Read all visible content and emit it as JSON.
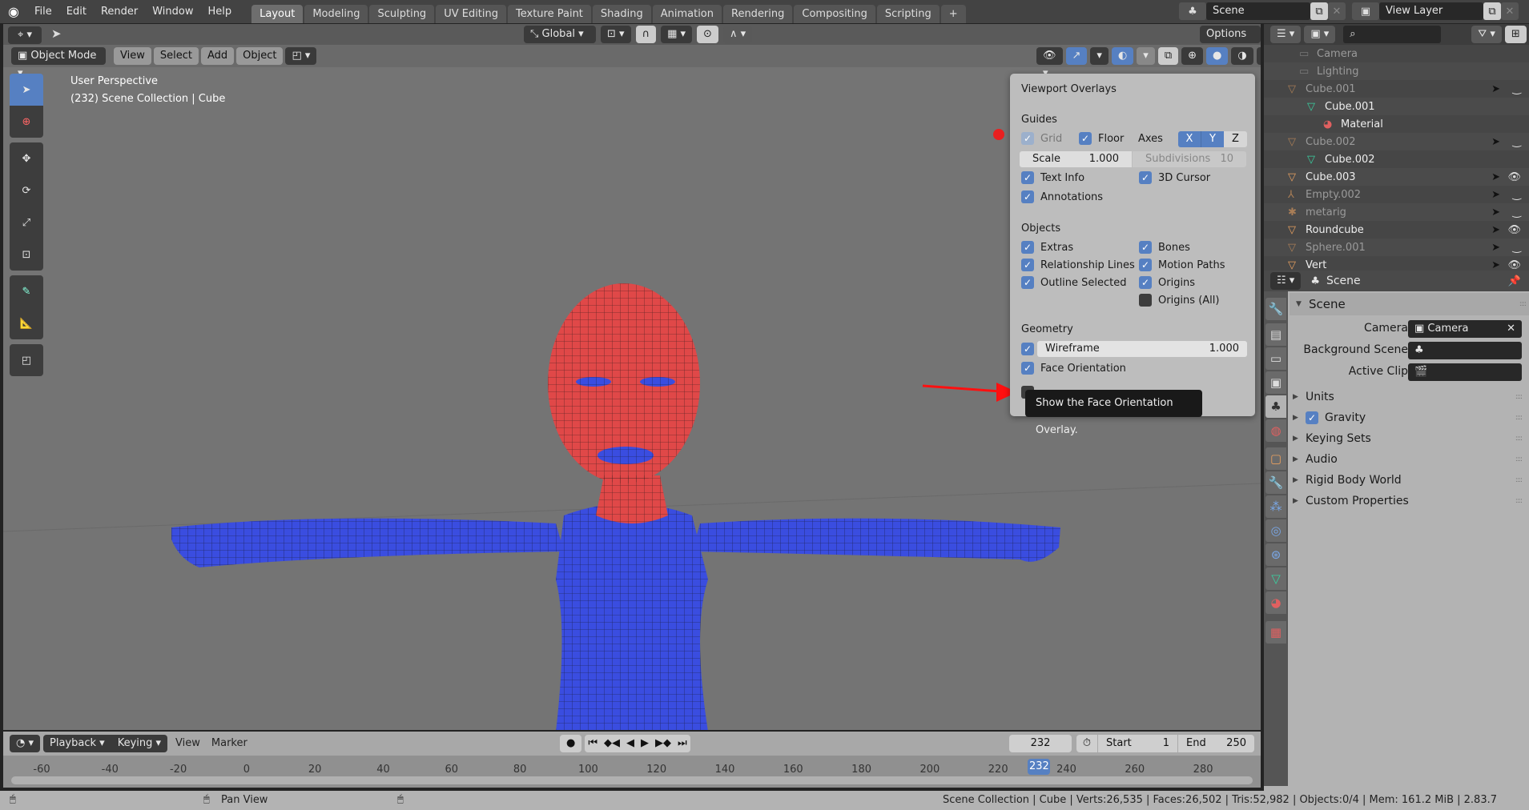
{
  "topbar": {
    "menus": [
      "File",
      "Edit",
      "Render",
      "Window",
      "Help"
    ],
    "workspaces": [
      "Layout",
      "Modeling",
      "Sculpting",
      "UV Editing",
      "Texture Paint",
      "Shading",
      "Animation",
      "Rendering",
      "Compositing",
      "Scripting"
    ],
    "active_workspace": "Layout",
    "add_tab": "+",
    "scene": "Scene",
    "view_layer": "View Layer"
  },
  "viewport": {
    "mode": "Object Mode",
    "menus": [
      "View",
      "Select",
      "Add",
      "Object"
    ],
    "transform_orientation": "Global",
    "options_label": "Options",
    "info_line1": "User Perspective",
    "info_line2": "(232) Scene Collection | Cube",
    "tools": [
      "select-box",
      "cursor",
      "move",
      "rotate",
      "scale",
      "transform",
      "annotate",
      "measure",
      "add-cube"
    ]
  },
  "overlays": {
    "title": "Viewport Overlays",
    "guides_heading": "Guides",
    "grid": "Grid",
    "floor": "Floor",
    "axes": "Axes",
    "axis_x": "X",
    "axis_y": "Y",
    "axis_z": "Z",
    "scale_label": "Scale",
    "scale_value": "1.000",
    "subdivisions_label": "Subdivisions",
    "subdivisions_value": "10",
    "text_info": "Text Info",
    "cursor_3d": "3D Cursor",
    "annotations": "Annotations",
    "objects_heading": "Objects",
    "extras": "Extras",
    "bones": "Bones",
    "relationship_lines": "Relationship Lines",
    "motion_paths": "Motion Paths",
    "outline_selected": "Outline Selected",
    "origins": "Origins",
    "origins_all": "Origins (All)",
    "geometry_heading": "Geometry",
    "wireframe": "Wireframe",
    "wireframe_value": "1.000",
    "face_orientation": "Face Orientation",
    "tooltip": "Show the Face Orientation Overlay."
  },
  "outliner": {
    "search_placeholder": "",
    "rows": [
      {
        "name": "Camera",
        "type": "collection",
        "dim": true
      },
      {
        "name": "Lighting",
        "type": "collection",
        "dim": true
      },
      {
        "name": "Cube.001",
        "type": "object",
        "dim": true,
        "visible": false
      },
      {
        "name": "Cube.001",
        "type": "mesh",
        "dim": false
      },
      {
        "name": "Material",
        "type": "material",
        "dim": false
      },
      {
        "name": "Cube.002",
        "type": "object",
        "dim": true,
        "visible": false
      },
      {
        "name": "Cube.002",
        "type": "mesh",
        "dim": false
      },
      {
        "name": "Cube.003",
        "type": "object",
        "dim": false,
        "visible": true
      },
      {
        "name": "Empty.002",
        "type": "empty",
        "dim": true,
        "visible": false
      },
      {
        "name": "metarig",
        "type": "armature",
        "dim": true,
        "visible": false
      },
      {
        "name": "Roundcube",
        "type": "object",
        "dim": false,
        "visible": true
      },
      {
        "name": "Sphere.001",
        "type": "object",
        "dim": true,
        "visible": false
      },
      {
        "name": "Vert",
        "type": "object",
        "dim": false,
        "visible": true
      }
    ]
  },
  "properties": {
    "context": "Scene",
    "panel_scene": "Scene",
    "camera_label": "Camera",
    "camera_value": "Camera",
    "background_scene_label": "Background Scene",
    "active_clip_label": "Active Clip",
    "subpanels": [
      "Units",
      "Gravity",
      "Keying Sets",
      "Audio",
      "Rigid Body World",
      "Custom Properties"
    ]
  },
  "timeline": {
    "playback": "Playback",
    "keying": "Keying",
    "view": "View",
    "marker": "Marker",
    "current_frame": "232",
    "start_label": "Start",
    "start_value": "1",
    "end_label": "End",
    "end_value": "250",
    "ticks": [
      "-60",
      "-40",
      "-20",
      "0",
      "20",
      "40",
      "60",
      "80",
      "100",
      "120",
      "140",
      "160",
      "180",
      "200",
      "220",
      "240",
      "260",
      "280"
    ],
    "playhead": "232"
  },
  "statusbar": {
    "pan_view": "Pan View",
    "stats": "Scene Collection | Cube | Verts:26,535 | Faces:26,502 | Tris:52,982 | Objects:0/4 | Mem: 161.2 MiB | 2.83.7"
  },
  "colors": {
    "accent": "#5680c2",
    "face_front": "#3a4de0",
    "face_back": "#e04848",
    "annotation_arrow": "#ff1010"
  }
}
